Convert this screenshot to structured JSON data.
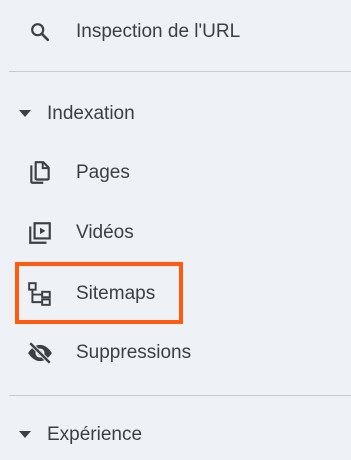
{
  "nav": {
    "url_inspection": {
      "label": "Inspection de l'URL",
      "icon": "search-icon"
    },
    "indexation": {
      "label": "Indexation",
      "icon": "caret-down-icon",
      "items": [
        {
          "label": "Pages",
          "icon": "pages-icon"
        },
        {
          "label": "Vidéos",
          "icon": "videos-icon"
        },
        {
          "label": "Sitemaps",
          "icon": "sitemap-icon"
        },
        {
          "label": "Suppressions",
          "icon": "visibility-off-icon"
        }
      ]
    },
    "experience": {
      "label": "Expérience",
      "icon": "caret-down-icon"
    }
  },
  "colors": {
    "background": "#eef2f7",
    "text": "#3c4043",
    "divider": "#c8ccd1",
    "highlight": "#ff5a0d"
  }
}
